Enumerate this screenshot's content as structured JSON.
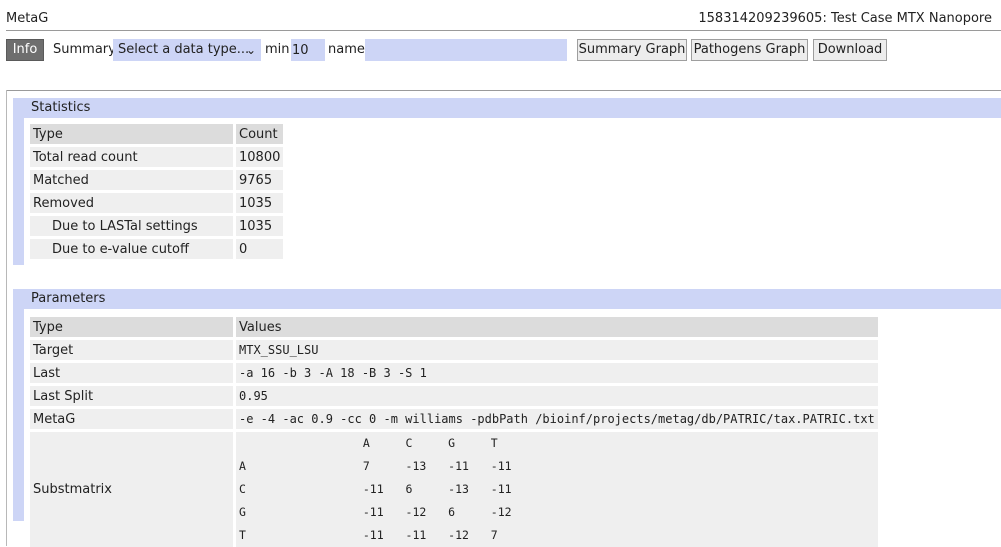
{
  "app": {
    "title": "MetaG",
    "run_title": "158314209239605: Test Case MTX Nanopore"
  },
  "toolbar": {
    "info_label": "Info",
    "summary_label": "Summary",
    "data_type_selected": "Select a data type...",
    "min_label": "min",
    "min_value": "10",
    "name_label": "name",
    "name_value": "",
    "summary_graph_label": "Summary Graph",
    "pathogens_graph_label": "Pathogens Graph",
    "download_label": "Download"
  },
  "statistics": {
    "title": "Statistics",
    "headers": [
      "Type",
      "Count"
    ],
    "rows": [
      {
        "type": "Total read count",
        "count": "10800"
      },
      {
        "type": "Matched",
        "count": "9765"
      },
      {
        "type": "Removed",
        "count": "1035"
      },
      {
        "type": "Due to LASTal settings",
        "count": "1035"
      },
      {
        "type": "Due to e-value cutoff",
        "count": "0"
      }
    ]
  },
  "parameters": {
    "title": "Parameters",
    "headers": [
      "Type",
      "Values"
    ],
    "rows": [
      {
        "type": "Target",
        "value": "MTX_SSU_LSU"
      },
      {
        "type": "Last",
        "value": "-a 16 -b 3 -A 18 -B 3 -S 1"
      },
      {
        "type": "Last Split",
        "value": "0.95"
      },
      {
        "type": "MetaG",
        "value": "-e -4 -ac 0.9 -cc 0 -m williams -pdbPath /bioinf/projects/metag/db/PATRIC/tax.PATRIC.txt"
      }
    ],
    "substmatrix": {
      "label": "Substmatrix",
      "columns": [
        "",
        "A",
        "C",
        "G",
        "T"
      ],
      "rows": [
        [
          "A",
          "7",
          "-13",
          "-11",
          "-11"
        ],
        [
          "C",
          "-11",
          "6",
          "-13",
          "-11"
        ],
        [
          "G",
          "-11",
          "-12",
          "6",
          "-12"
        ],
        [
          "T",
          "-11",
          "-11",
          "-12",
          "7"
        ]
      ]
    }
  }
}
